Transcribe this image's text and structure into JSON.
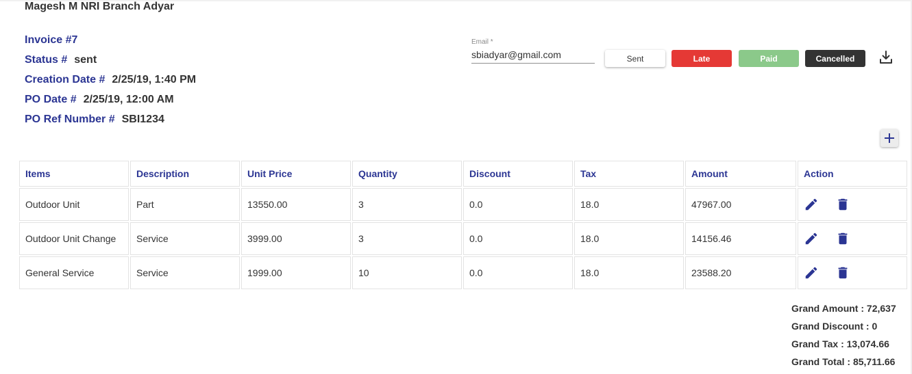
{
  "header": {
    "branch": "Magesh M NRI Branch Adyar"
  },
  "invoice": {
    "title": "Invoice #7",
    "status_label": "Status #",
    "status_value": "sent",
    "creation_label": "Creation Date #",
    "creation_value": "2/25/19, 1:40 PM",
    "po_date_label": "PO Date #",
    "po_date_value": "2/25/19, 12:00 AM",
    "po_ref_label": "PO Ref Number #",
    "po_ref_value": "SBI1234"
  },
  "email": {
    "label": "Email *",
    "value": "sbiadyar@gmail.com"
  },
  "status_buttons": {
    "sent": "Sent",
    "late": "Late",
    "paid": "Paid",
    "cancelled": "Cancelled"
  },
  "icons": {
    "download": "download-icon",
    "add": "plus-icon",
    "edit": "pencil-icon",
    "delete": "trash-icon"
  },
  "colors": {
    "accent": "#2b3593",
    "late": "#e53935",
    "paid": "#8bc98a",
    "cancelled": "#333333"
  },
  "table": {
    "headers": [
      "Items",
      "Description",
      "Unit Price",
      "Quantity",
      "Discount",
      "Tax",
      "Amount",
      "Action"
    ],
    "rows": [
      [
        "Outdoor Unit",
        "Part",
        "13550.00",
        "3",
        "0.0",
        "18.0",
        "47967.00"
      ],
      [
        "Outdoor Unit Change",
        "Service",
        "3999.00",
        "3",
        "0.0",
        "18.0",
        "14156.46"
      ],
      [
        "General Service",
        "Service",
        "1999.00",
        "10",
        "0.0",
        "18.0",
        "23588.20"
      ]
    ]
  },
  "totals": {
    "grand_amount": "Grand Amount : 72,637",
    "grand_discount": "Grand Discount : 0",
    "grand_tax": "Grand Tax : 13,074.66",
    "grand_total": "Grand Total : 85,711.66"
  }
}
